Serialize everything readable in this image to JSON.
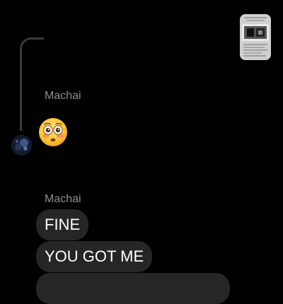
{
  "thread": {
    "attachment_icon": "image-attachment-thumbnail",
    "first_group": {
      "sender": "Machai",
      "reaction_emoji": "flushed-face-emoji"
    },
    "second_group": {
      "sender": "Machai",
      "messages": [
        {
          "text": "FINE"
        },
        {
          "text": "YOU GOT ME"
        },
        {
          "text": ""
        }
      ]
    }
  },
  "colors": {
    "background": "#000000",
    "incoming_bubble": "#262629",
    "sender_label": "#8e8e93",
    "reply_thread_line": "#3a3a3c"
  }
}
